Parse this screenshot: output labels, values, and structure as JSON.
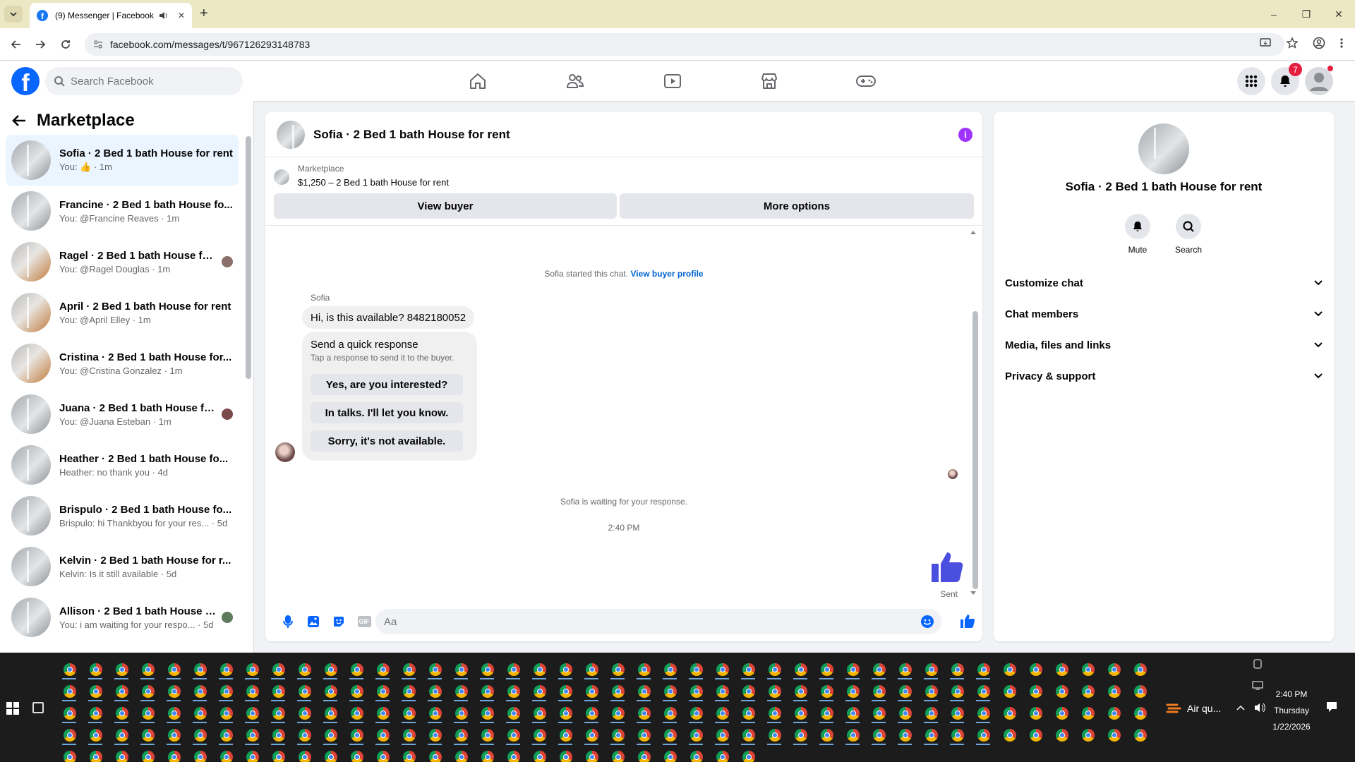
{
  "browser": {
    "tab_title": "(9) Messenger | Facebook",
    "url": "facebook.com/messages/t/967126293148783",
    "new_tab": "+",
    "minimize": "–",
    "restore": "❐",
    "close": "✕"
  },
  "fb": {
    "search_placeholder": "Search Facebook",
    "notification_count": "7",
    "logo_letter": "f",
    "brand_color": "#0866ff"
  },
  "left": {
    "title": "Marketplace",
    "conversations": [
      {
        "name": "Sofia · 2 Bed 1 bath House for rent",
        "sub": "You: 👍 · 1m"
      },
      {
        "name": "Francine · 2 Bed 1 bath House fo...",
        "sub": "You: @Francine Reaves · 1m"
      },
      {
        "name": "Ragel · 2 Bed 1 bath House for...",
        "sub": "You: @Ragel Douglas · 1m"
      },
      {
        "name": "April · 2 Bed 1 bath House for rent",
        "sub": "You: @April Elley · 1m"
      },
      {
        "name": "Cristina · 2 Bed 1 bath House for...",
        "sub": "You: @Cristina Gonzalez · 1m"
      },
      {
        "name": "Juana · 2 Bed 1 bath House fo...",
        "sub": "You: @Juana Esteban · 1m"
      },
      {
        "name": "Heather · 2 Bed 1 bath House fo...",
        "sub": "Heather: no thank you · 4d"
      },
      {
        "name": "Brispulo · 2 Bed 1 bath House fo...",
        "sub": "Brispulo: hi Thankbyou for your res... · 5d"
      },
      {
        "name": "Kelvin · 2 Bed 1 bath House for r...",
        "sub": "Kelvin: Is it still available · 5d"
      },
      {
        "name": "Allison · 2 Bed 1 bath House f...",
        "sub": "You: i am waiting for your respo... · 5d"
      }
    ]
  },
  "chat": {
    "title": "Sofia · 2 Bed 1 bath House for rent",
    "info_icon": "i",
    "marketplace_label": "Marketplace",
    "listing": "$1,250 – 2 Bed 1 bath House for rent",
    "view_buyer": "View buyer",
    "more_options": "More options",
    "started": "Sofia started this chat.",
    "view_buyer_profile": "View buyer profile",
    "sender": "Sofia",
    "message": "Hi, is this available? 8482180052",
    "quick_title": "Send a quick response",
    "quick_sub": "Tap a response to send it to the buyer.",
    "quick_replies": [
      "Yes, are you interested?",
      "In talks. I'll let you know.",
      "Sorry, it's not available."
    ],
    "waiting": "Sofia is waiting for your response.",
    "time": "2:40 PM",
    "sent": "Sent",
    "input_placeholder": "Aa",
    "gif_label": "GIF"
  },
  "right": {
    "name": "Sofia · 2 Bed 1 bath House for rent",
    "mute": "Mute",
    "search": "Search",
    "sections": [
      "Customize chat",
      "Chat members",
      "Media, files and links",
      "Privacy & support"
    ]
  },
  "taskbar": {
    "weather": "Air qu...",
    "time": "2:40 PM",
    "day": "Thursday",
    "date": "1/22/2026"
  }
}
